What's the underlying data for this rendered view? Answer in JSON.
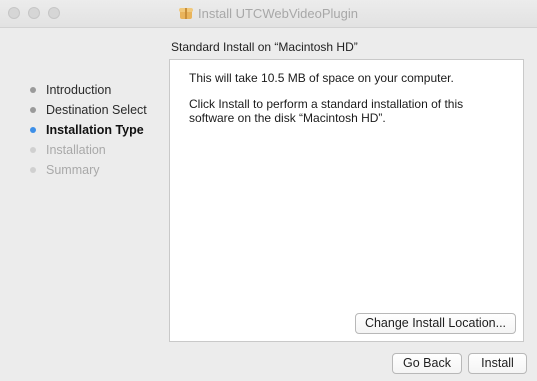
{
  "window": {
    "title": "Install UTCWebVideoPlugin",
    "title_icon": "package-icon"
  },
  "subtitle": "Standard Install on “Macintosh HD”",
  "steps": [
    {
      "label": "Introduction",
      "state": "done"
    },
    {
      "label": "Destination Select",
      "state": "done"
    },
    {
      "label": "Installation Type",
      "state": "current"
    },
    {
      "label": "Installation",
      "state": "pending"
    },
    {
      "label": "Summary",
      "state": "pending"
    }
  ],
  "content": {
    "space_text": "This will take 10.5 MB of space on your computer.",
    "instructions": "Click Install to perform a standard installation of this software on the disk “Macintosh HD”."
  },
  "buttons": {
    "change_location": "Change Install Location...",
    "go_back": "Go Back",
    "install": "Install"
  },
  "colors": {
    "current_step_dot": "#3d8fe8",
    "window_background": "#ececec",
    "panel_background": "#ffffff"
  }
}
